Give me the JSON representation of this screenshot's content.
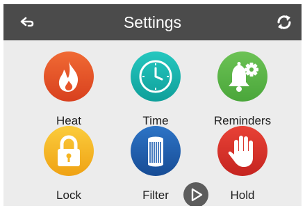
{
  "header": {
    "title": "Settings"
  },
  "tiles": [
    {
      "label": "Heat",
      "icon": "flame-icon",
      "color": "#e8552a"
    },
    {
      "label": "Time",
      "icon": "clock-icon",
      "color": "#16b6b0"
    },
    {
      "label": "Reminders",
      "icon": "bell-gear-icon",
      "color": "#5cb447"
    },
    {
      "label": "Lock",
      "icon": "padlock-icon",
      "color": "#f5b522"
    },
    {
      "label": "Filter",
      "icon": "filter-cartridge-icon",
      "color": "#1f5fb0"
    },
    {
      "label": "Hold",
      "icon": "hand-icon",
      "color": "#d8302c"
    }
  ],
  "colors": {
    "topbar": "#4b4b4b",
    "background": "#ececec",
    "play_button": "#5c5c5c"
  }
}
